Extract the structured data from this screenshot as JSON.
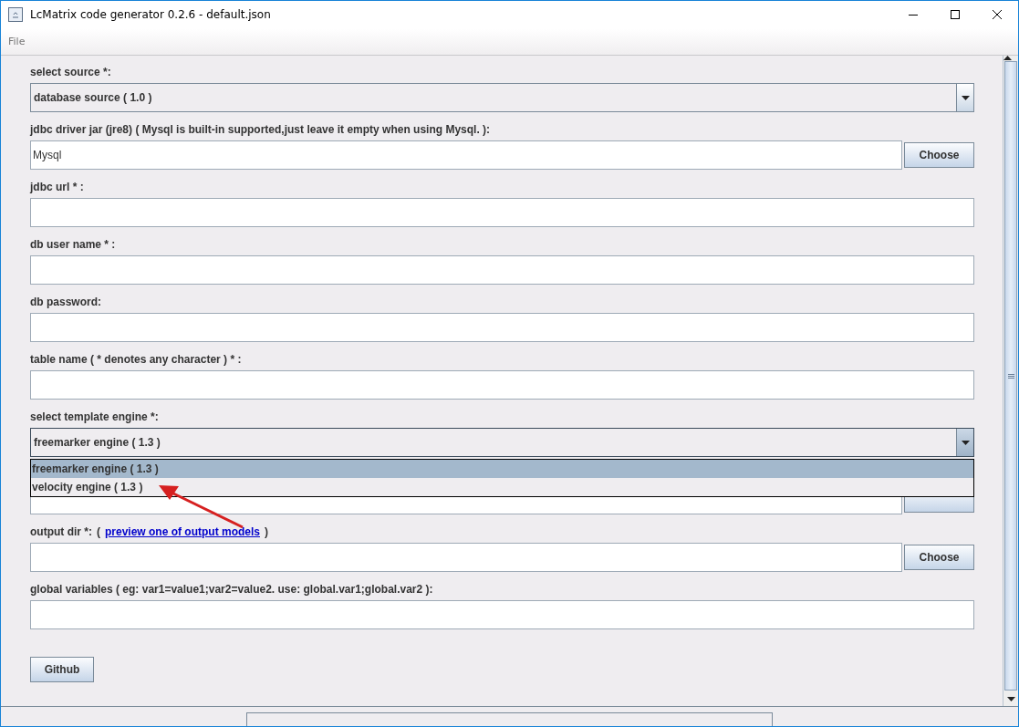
{
  "window": {
    "title": "LcMatrix code generator 0.2.6 - default.json"
  },
  "menu": [
    {
      "label": "File"
    }
  ],
  "fields": [
    {
      "kind": "combo",
      "label": "select source *:",
      "value": "database source ( 1.0 )"
    },
    {
      "kind": "file",
      "label": "jdbc driver jar (jre8) ( Mysql is built-in supported,just leave it empty when using Mysql. ):",
      "value": "Mysql",
      "button": "Choose"
    },
    {
      "kind": "text",
      "label": "jdbc url * :"
    },
    {
      "kind": "text",
      "label": "db user name * :"
    },
    {
      "kind": "text",
      "label": "db password:"
    },
    {
      "kind": "text",
      "label": "table name ( * denotes any character ) * :"
    },
    {
      "kind": "combo",
      "label": "select template engine *:",
      "value": "freemarker engine ( 1.3 )",
      "expanded": true,
      "options": [
        {
          "label": "freemarker engine ( 1.3 )",
          "selected": true
        },
        {
          "label": "velocity engine ( 1.3 )",
          "selected": false
        }
      ]
    },
    {
      "kind": "file"
    },
    {
      "kind": "file",
      "label": "output dir *:",
      "link_before": "(",
      "link": "preview one of output models",
      "link_after": ")",
      "button": "Choose"
    },
    {
      "kind": "text",
      "label": "global variables ( eg: var1=value1;var2=value2. use: global.var1;global.var2 ):"
    }
  ],
  "buttons": [
    "Github"
  ]
}
